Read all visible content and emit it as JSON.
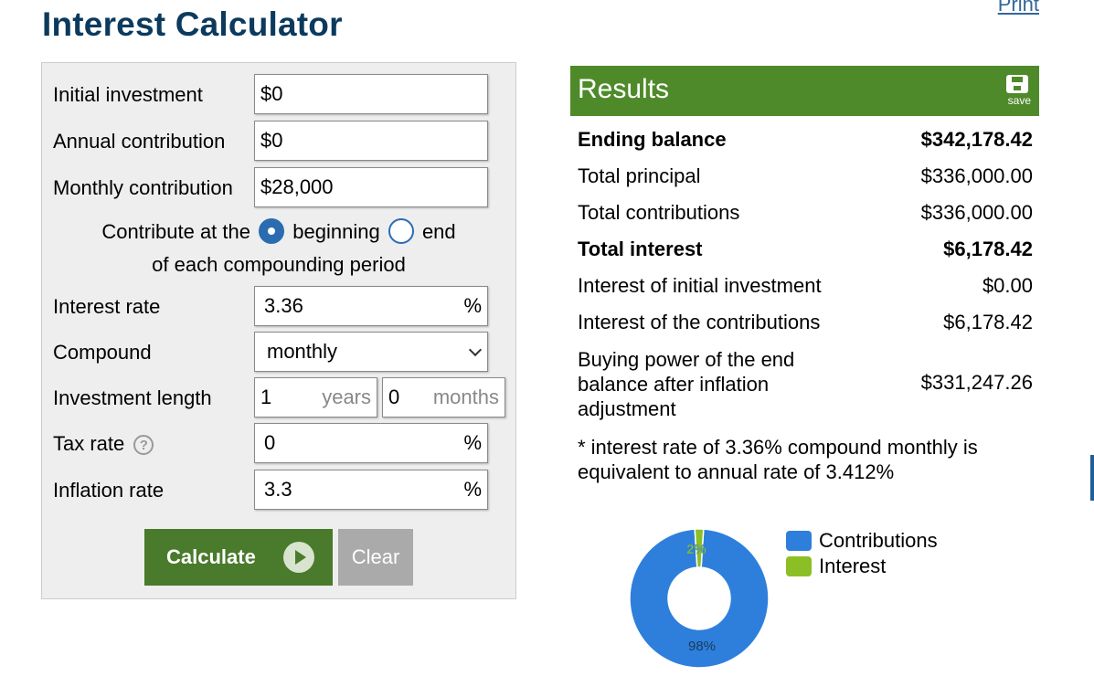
{
  "page": {
    "title": "Interest Calculator",
    "print_label": "Print"
  },
  "form": {
    "initial_investment": {
      "label": "Initial investment",
      "value": "$0"
    },
    "annual_contribution": {
      "label": "Annual contribution",
      "value": "$0"
    },
    "monthly_contribution": {
      "label": "Monthly contribution",
      "value": "$28,000"
    },
    "contribute_timing": {
      "prefix": "Contribute at the",
      "option_beginning": "beginning",
      "option_end": "end",
      "suffix": "of each compounding period",
      "selected": "beginning"
    },
    "interest_rate": {
      "label": "Interest rate",
      "value": "3.36",
      "unit": "%"
    },
    "compound": {
      "label": "Compound",
      "value": "monthly"
    },
    "investment_length": {
      "label": "Investment length",
      "years": "1",
      "years_unit": "years",
      "months": "0",
      "months_unit": "months"
    },
    "tax_rate": {
      "label": "Tax rate",
      "value": "0",
      "unit": "%",
      "help": "?"
    },
    "inflation_rate": {
      "label": "Inflation rate",
      "value": "3.3",
      "unit": "%"
    },
    "calculate_label": "Calculate",
    "clear_label": "Clear"
  },
  "results": {
    "title": "Results",
    "save_label": "save",
    "rows": [
      {
        "key": "Ending balance",
        "value": "$342,178.42"
      },
      {
        "key": "Total principal",
        "value": "$336,000.00"
      },
      {
        "key": "Total contributions",
        "value": "$336,000.00"
      },
      {
        "key": "Total interest",
        "value": "$6,178.42"
      },
      {
        "key": "Interest of initial investment",
        "value": "$0.00"
      },
      {
        "key": "Interest of the contributions",
        "value": "$6,178.42"
      }
    ],
    "buying_power": {
      "line1": "Buying power of the end",
      "line2": "balance after inflation",
      "line3": "adjustment",
      "value": "$331,247.26"
    },
    "footnote_line1": "* interest rate of 3.36% compound monthly is",
    "footnote_line2": "equivalent to annual rate of 3.412%"
  },
  "chart_data": {
    "type": "pie",
    "categories": [
      "Contributions",
      "Interest"
    ],
    "values": [
      98,
      2
    ],
    "data_labels": [
      "98%",
      "2%"
    ],
    "colors": [
      "#2e7fdc",
      "#8cbf26"
    ],
    "legend_position": "right"
  }
}
